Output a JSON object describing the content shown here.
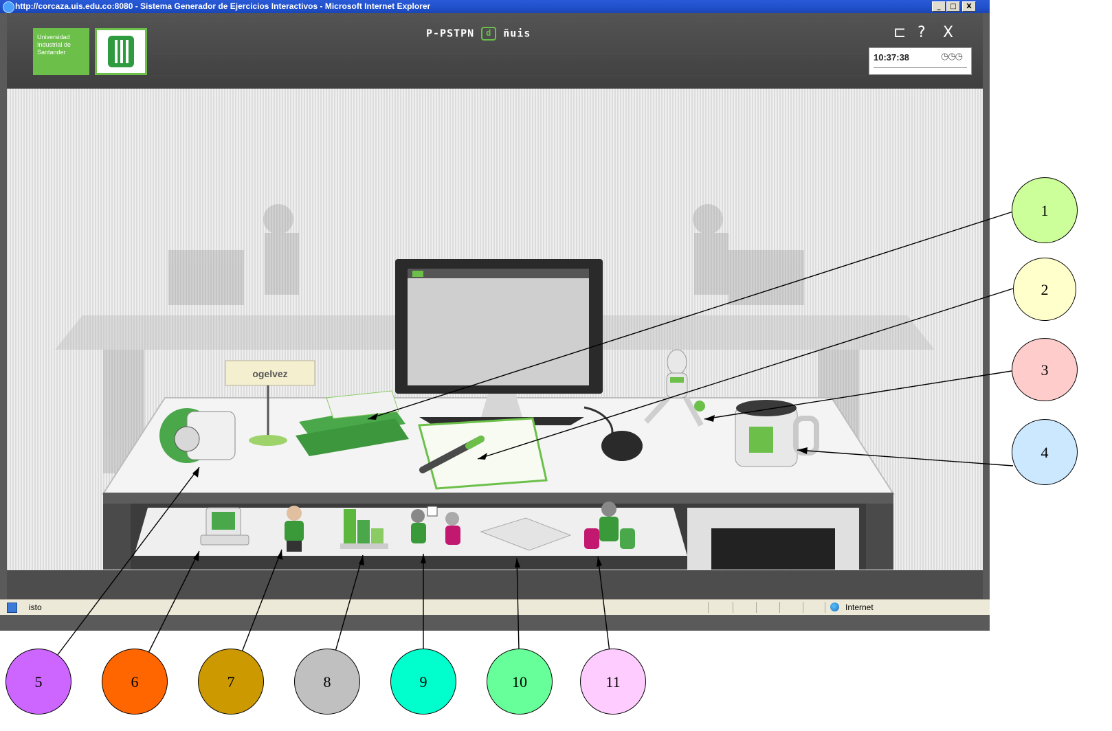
{
  "browser": {
    "title": "http://corcaza.uis.edu.co:8080 - Sistema Generador de Ejercicios Interactivos - Microsoft Internet Explorer",
    "min_label": "_",
    "max_label": "□",
    "close_label": "X"
  },
  "app": {
    "logo_text": "Universidad Industrial de Santander",
    "name": "P-PSTPN",
    "name_mark": "d",
    "name_suffix": "ñuis",
    "controls": [
      "⊏",
      "?",
      "X"
    ],
    "clock_time": "10:37:38",
    "clock_icons": "◷◷◷"
  },
  "scene": {
    "nameplate": "ogelvez"
  },
  "status": {
    "text": "isto",
    "zone": "Internet"
  },
  "callouts": [
    {
      "label": "1",
      "color": "#ccff99"
    },
    {
      "label": "2",
      "color": "#ffffcc"
    },
    {
      "label": "3",
      "color": "#ffcccc"
    },
    {
      "label": "4",
      "color": "#cce8ff"
    },
    {
      "label": "5",
      "color": "#cc66ff"
    },
    {
      "label": "6",
      "color": "#ff6600"
    },
    {
      "label": "7",
      "color": "#cc9900"
    },
    {
      "label": "8",
      "color": "#c0c0c0"
    },
    {
      "label": "9",
      "color": "#00ffcc"
    },
    {
      "label": "10",
      "color": "#66ff99"
    },
    {
      "label": "11",
      "color": "#ffccff"
    }
  ]
}
